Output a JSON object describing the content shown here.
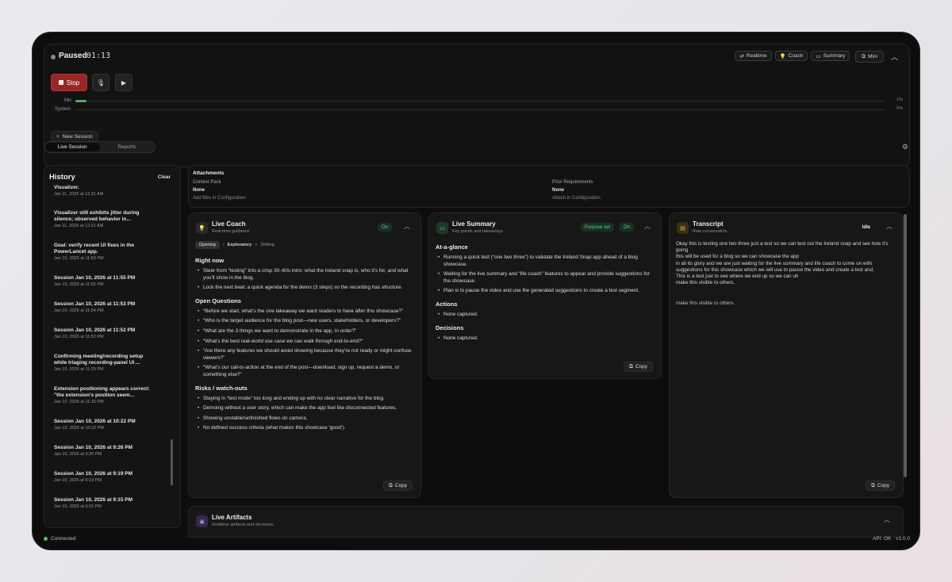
{
  "header": {
    "status": "Paused",
    "timer": "01:13",
    "pills": [
      {
        "icon": "realtime-icon",
        "label": "Realtime"
      },
      {
        "icon": "lightbulb-icon",
        "label": "Coach"
      },
      {
        "icon": "message-icon",
        "label": "Summary"
      },
      {
        "icon": "window-icon",
        "label": "Mini"
      }
    ],
    "stop_label": "Stop",
    "mic_label": "Mic",
    "mic_level": "1%",
    "mic_fraction": 0.01,
    "system_label": "System",
    "system_level": "0%",
    "system_fraction": 0,
    "new_session_label": "New Session"
  },
  "tabs": [
    "Live Session",
    "Reports"
  ],
  "history": {
    "title": "History",
    "clear_label": "Clear",
    "items": [
      {
        "title": "Visualizer.",
        "date": "Jan 11, 2026 at 12:31 AM"
      },
      {
        "title": "Visualizer still exhibits jitter during silence; observed behavior in...",
        "date": "Jan 11, 2026 at 12:21 AM"
      },
      {
        "title": "Goal: verify recent UI fixes in the PowerLancet app.",
        "date": "Jan 10, 2026 at 11:59 PM"
      },
      {
        "title": "Session Jan 10, 2026 at 11:55 PM",
        "date": "Jan 10, 2026 at 11:55 PM"
      },
      {
        "title": "Session Jan 10, 2026 at 11:53 PM",
        "date": "Jan 10, 2026 at 11:54 PM"
      },
      {
        "title": "Session Jan 10, 2026 at 11:52 PM",
        "date": "Jan 10, 2026 at 11:52 PM"
      },
      {
        "title": "Confirming meeting/recording setup while triaging recording-panel UI ...",
        "date": "Jan 10, 2026 at 11:29 PM"
      },
      {
        "title": "Extension positioning appears correct: \"the extension's position seem...",
        "date": "Jan 10, 2026 at 11:15 PM"
      },
      {
        "title": "Session Jan 10, 2026 at 10:22 PM",
        "date": "Jan 10, 2026 at 10:22 PM"
      },
      {
        "title": "Session Jan 10, 2026 at 9:26 PM",
        "date": "Jan 10, 2026 at 9:26 PM"
      },
      {
        "title": "Session Jan 10, 2026 at 9:19 PM",
        "date": "Jan 10, 2026 at 9:19 PM"
      },
      {
        "title": "Session Jan 10, 2026 at 9:15 PM",
        "date": "Jan 10, 2026 at 9:15 PM"
      }
    ]
  },
  "attachments": {
    "title": "Attachments",
    "context_label": "Context Pack",
    "context_value": "None",
    "context_hint": "Add files in Configuration",
    "prior_label": "Prior Requirements",
    "prior_value": "None",
    "prior_hint": "Attach in Configuration"
  },
  "coach": {
    "title": "Live Coach",
    "subtitle": "Real-time guidance",
    "badge": "On",
    "stages": [
      "Opening",
      "Exploratory",
      "Drifting"
    ],
    "sections": [
      {
        "heading": "Right now",
        "items": [
          "Steer from “testing” into a crisp 30–60s intro: what the Ireland snap is, who it’s for, and what you’ll show in the blog.",
          "Lock the next beat: a quick agenda for the demo (3 steps) so the recording has structure."
        ]
      },
      {
        "heading": "Open Questions",
        "items": [
          "“Before we start, what’s the one takeaway we want readers to have after this showcase?”",
          "“Who is the target audience for the blog post—new users, stakeholders, or developers?”",
          "“What are the 3 things we want to demonstrate in the app, in order?”",
          "“What’s the best real-world use case we can walk through end-to-end?”",
          "“Are there any features we should avoid showing because they’re not ready or might confuse viewers?”",
          "“What’s our call-to-action at the end of the post—download, sign up, request a demo, or something else?”"
        ]
      },
      {
        "heading": "Risks / watch-outs",
        "items": [
          "Staying in “test mode” too long and ending up with no clear narrative for the blog.",
          "Demoing without a user story, which can make the app feel like disconnected features.",
          "Showing unstable/unfinished flows on camera.",
          "No defined success criteria (what makes this showcase ‘good’)."
        ]
      }
    ],
    "copy_label": "Copy"
  },
  "summary": {
    "title": "Live Summary",
    "subtitle": "Key points and takeaways",
    "badge_purpose": "Purpose set",
    "badge_on": "On",
    "sections": [
      {
        "heading": "At-a-glance",
        "items": [
          "Running a quick test (“one two three”) to validate the Ireland Snap app ahead of a blog showcase.",
          "Waiting for the live summary and “life coach” features to appear and provide suggestions for the showcase.",
          "Plan is to pause the video and use the generated suggestions to create a test segment."
        ]
      },
      {
        "heading": "Actions",
        "items": [
          "None captured."
        ]
      },
      {
        "heading": "Decisions",
        "items": [
          "None captured."
        ]
      }
    ],
    "copy_label": "Copy"
  },
  "transcript": {
    "title": "Transcript",
    "subtitle": "Raw conversation",
    "badge": "Idle",
    "text": "Okay this is testing one two three just a test so we can test out the Ireland snap and see how it's going\nthis will be used for a blog so we can showcase the app\nin all its glory and we are just waiting for the live summary and life coach to come on with suggestions for this showcase which we will use to pause the video and create a test and.\nThis is a test just to see where we end up so we can uh\nmake this visible to others.",
    "text2": "make this visible to others.",
    "copy_label": "Copy"
  },
  "artifacts": {
    "title": "Live Artifacts",
    "subtitle": "Realtime artifacts and decisions"
  },
  "footer": {
    "connection": "Connected",
    "api": "API: OK",
    "version": "v1.0.0"
  },
  "colors": {
    "stop": "#9a2626",
    "on_badge": "#5fd08a",
    "connected": "#4ec25f"
  }
}
